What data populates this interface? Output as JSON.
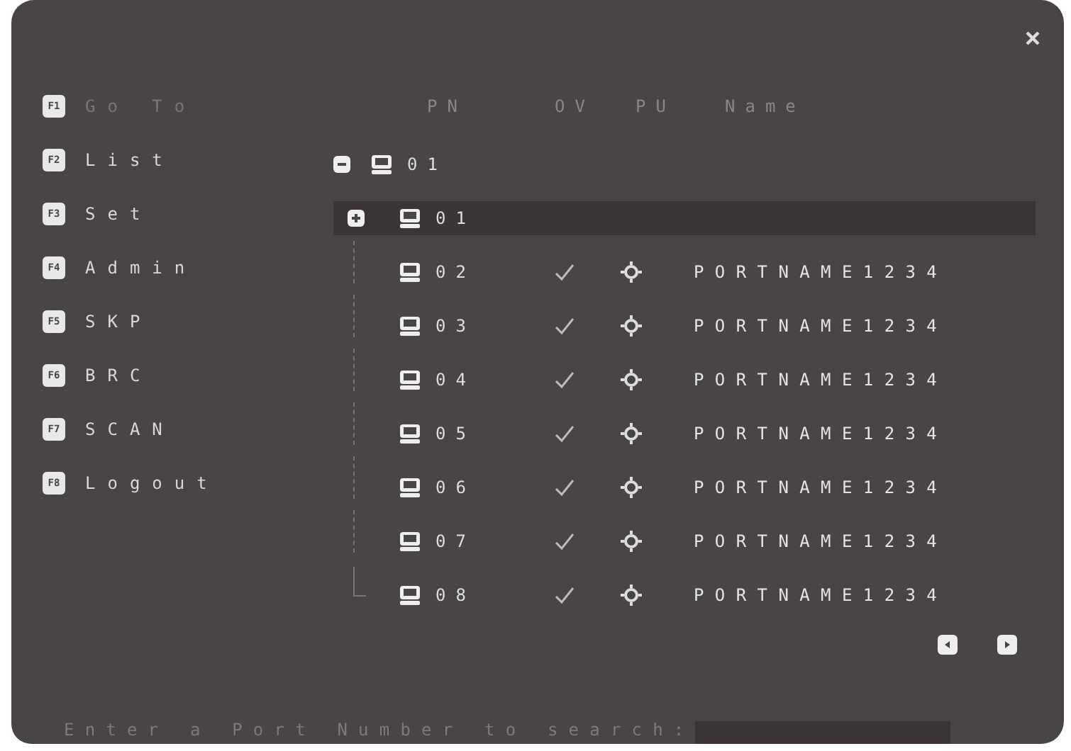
{
  "menu": [
    {
      "key": "F1",
      "label": "Go To",
      "disabled": true
    },
    {
      "key": "F2",
      "label": "List",
      "disabled": false
    },
    {
      "key": "F3",
      "label": "Set",
      "disabled": false
    },
    {
      "key": "F4",
      "label": "Admin",
      "disabled": false
    },
    {
      "key": "F5",
      "label": "SKP",
      "disabled": false
    },
    {
      "key": "F6",
      "label": "BRC",
      "disabled": false
    },
    {
      "key": "F7",
      "label": "SCAN",
      "disabled": false
    },
    {
      "key": "F8",
      "label": "Logout",
      "disabled": false
    }
  ],
  "table": {
    "columns": [
      "PN",
      "OV",
      "PU",
      "Name"
    ],
    "tree": [
      {
        "pn": "01",
        "expanded": true,
        "selected": false,
        "children": [
          {
            "pn": "01",
            "expanded": false,
            "selected": true
          },
          {
            "pn": "02",
            "selected": false,
            "ov": true,
            "pu": true,
            "name": "PORTNAME1234"
          },
          {
            "pn": "03",
            "selected": false,
            "ov": true,
            "pu": true,
            "name": "PORTNAME1234"
          },
          {
            "pn": "04",
            "selected": false,
            "ov": true,
            "pu": true,
            "name": "PORTNAME1234"
          },
          {
            "pn": "05",
            "selected": false,
            "ov": true,
            "pu": true,
            "name": "PORTNAME1234"
          },
          {
            "pn": "06",
            "selected": false,
            "ov": true,
            "pu": true,
            "name": "PORTNAME1234"
          },
          {
            "pn": "07",
            "selected": false,
            "ov": true,
            "pu": true,
            "name": "PORTNAME1234"
          },
          {
            "pn": "08",
            "selected": false,
            "ov": true,
            "pu": true,
            "name": "PORTNAME1234"
          }
        ]
      }
    ]
  },
  "search": {
    "prompt": "Enter a Port Number to search:"
  }
}
